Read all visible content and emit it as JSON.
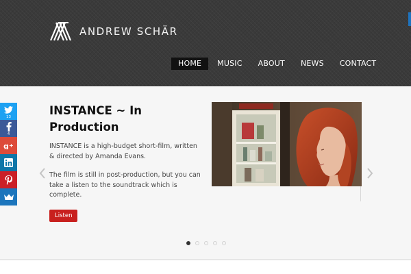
{
  "site": {
    "logo_text": "ANDREW SCHÄR"
  },
  "nav": {
    "items": [
      {
        "label": "HOME",
        "active": true
      },
      {
        "label": "MUSIC",
        "active": false
      },
      {
        "label": "ABOUT",
        "active": false
      },
      {
        "label": "NEWS",
        "active": false
      },
      {
        "label": "CONTACT",
        "active": false
      }
    ]
  },
  "slide": {
    "title": "INSTANCE ~ In Production",
    "paragraph_1": "INSTANCE is a high-budget short-film, written & directed by Amanda Evans.",
    "paragraph_2": "The film is still in post-production, but you can take a listen to the soundtrack which is complete.",
    "button_label": "Listen",
    "image_icon": "film-still-woman-red-hair"
  },
  "slider": {
    "dots_count": 5,
    "active_index": 0,
    "prev_icon": "chevron-left-icon",
    "next_icon": "chevron-right-icon"
  },
  "share": {
    "buttons": [
      {
        "network": "twitter",
        "icon": "twitter-icon",
        "count": "13",
        "color": "#1da1f2"
      },
      {
        "network": "facebook",
        "icon": "facebook-icon",
        "count": "4",
        "color": "#3b5998"
      },
      {
        "network": "google-plus",
        "icon": "google-plus-icon",
        "count": "",
        "color": "#dd4b39"
      },
      {
        "network": "linkedin",
        "icon": "linkedin-icon",
        "count": "",
        "color": "#0e76a8"
      },
      {
        "network": "pinterest",
        "icon": "pinterest-icon",
        "count": "",
        "color": "#cb2027"
      },
      {
        "network": "share",
        "icon": "share-crown-icon",
        "count": "",
        "color": "#1c75bc"
      }
    ]
  },
  "colors": {
    "header_bg": "#3a3a3a",
    "nav_active_bg": "#111111",
    "button_red": "#c8201e",
    "slider_bg": "#f6f6f6"
  }
}
